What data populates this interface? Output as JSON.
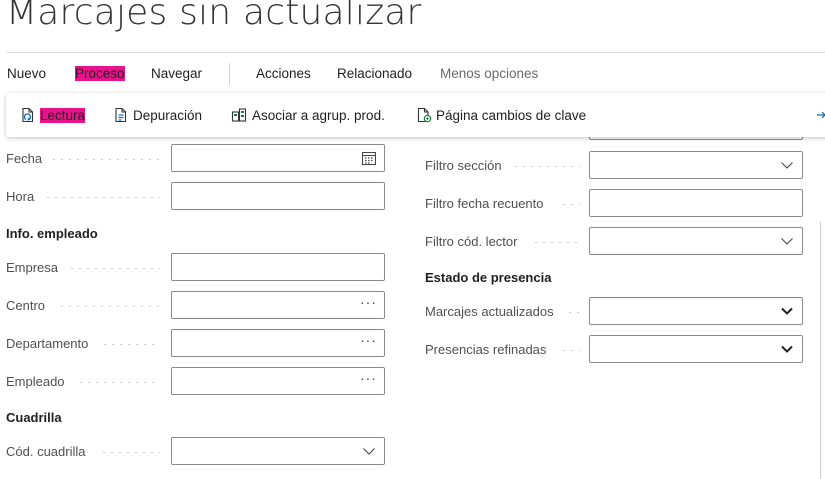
{
  "page": {
    "title": "Marcajes sin actualizar"
  },
  "menu": {
    "items": [
      {
        "label": "Nuevo"
      },
      {
        "label": "Proceso"
      },
      {
        "label": "Navegar"
      },
      {
        "label": "Acciones"
      },
      {
        "label": "Relacionado"
      },
      {
        "label": "Menos opciones"
      }
    ]
  },
  "ribbon": {
    "actions": [
      {
        "label": "Lectura",
        "icon": "document-refresh-icon"
      },
      {
        "label": "Depuración",
        "icon": "document-cleanup-icon"
      },
      {
        "label": "Asociar a agrup. prod.",
        "icon": "link-group-icon"
      },
      {
        "label": "Página cambios de clave",
        "icon": "document-change-icon"
      }
    ],
    "more_icon": "expand-pane-icon"
  },
  "left": {
    "fecha": {
      "label": "Fecha",
      "value": "",
      "icon": "calendar-icon"
    },
    "hora": {
      "label": "Hora",
      "value": ""
    },
    "empleado_section": "Info. empleado",
    "empresa": {
      "label": "Empresa",
      "value": ""
    },
    "centro": {
      "label": "Centro",
      "value": "",
      "icon": "ellipsis-icon",
      "ellipsis": "···"
    },
    "departamento": {
      "label": "Departamento",
      "value": "",
      "icon": "ellipsis-icon",
      "ellipsis": "···"
    },
    "empleado": {
      "label": "Empleado",
      "value": "",
      "icon": "ellipsis-icon",
      "ellipsis": "···"
    },
    "cuadrilla_section": "Cuadrilla",
    "cod_cuadrilla": {
      "label": "Cód. cuadrilla",
      "value": "",
      "icon": "chevron-down-icon"
    }
  },
  "right": {
    "filtro_seccion": {
      "label": "Filtro sección",
      "value": "",
      "icon": "chevron-down-icon"
    },
    "filtro_fecha_recuento": {
      "label": "Filtro fecha recuento",
      "value": ""
    },
    "filtro_cod_lector": {
      "label": "Filtro cód. lector",
      "value": "",
      "icon": "chevron-down-icon"
    },
    "presencia_section": "Estado de presencia",
    "marcajes_actualizados": {
      "label": "Marcajes actualizados",
      "value": "",
      "icon": "chevron-down-icon"
    },
    "presencias_refinadas": {
      "label": "Presencias refinadas",
      "value": "",
      "icon": "chevron-down-icon"
    }
  },
  "colors": {
    "highlight": "#e8138a",
    "icon_blue": "#0f6cbd",
    "icon_green": "#107c41",
    "border": "#8a8a8a"
  }
}
